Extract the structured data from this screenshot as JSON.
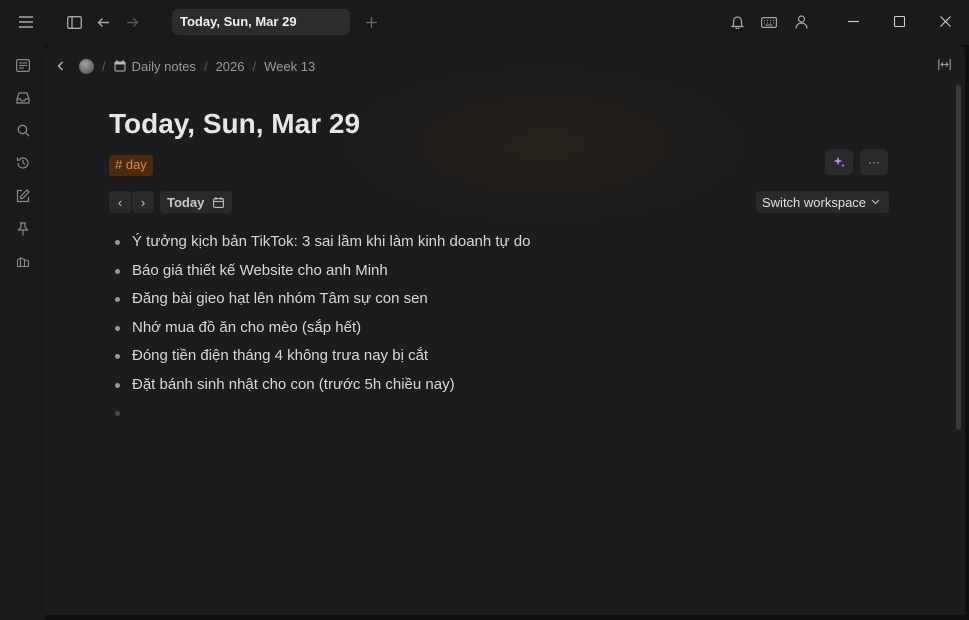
{
  "titlebar": {
    "tab_title": "Today, Sun, Mar 29",
    "icons": [
      "menu-icon",
      "sidebar-toggle-icon",
      "back-arrow-icon",
      "forward-arrow-icon",
      "new-tab-plus-icon",
      "bell-icon",
      "keyboard-icon",
      "user-icon",
      "minimize-icon",
      "maximize-icon",
      "close-icon"
    ]
  },
  "sidebar": {
    "icons": [
      "journals-icon",
      "inbox-icon",
      "search-icon",
      "history-icon",
      "edit-icon",
      "pin-icon",
      "dashboard-icon"
    ]
  },
  "breadcrumb": {
    "items": [
      "Daily notes",
      "2026",
      "Week 13"
    ],
    "separator": "/"
  },
  "page": {
    "title": "Today, Sun, Mar 29",
    "tag": "# day",
    "more_label": "···"
  },
  "toolbar": {
    "prev": "‹",
    "next": "›",
    "today_label": "Today",
    "switch_workspace_label": "Switch workspace"
  },
  "tasks": [
    "Ý tưởng kịch bản TikTok: 3 sai lầm khi làm kinh doanh tự do",
    "Báo giá thiết kế Website cho anh Minh",
    "Đăng bài gieo hạt lên nhóm Tâm sự con sen",
    "Nhớ mua đồ ăn cho mèo (sắp hết)",
    "Đóng tiền điện tháng 4 không trưa nay bị cắt",
    "Đặt bánh sinh nhật cho con (trước 5h chiều nay)",
    ""
  ],
  "colors": {
    "tag_bg": "#4a2a10",
    "tag_text": "#e08a3c",
    "sparkle": "#c586f0"
  }
}
